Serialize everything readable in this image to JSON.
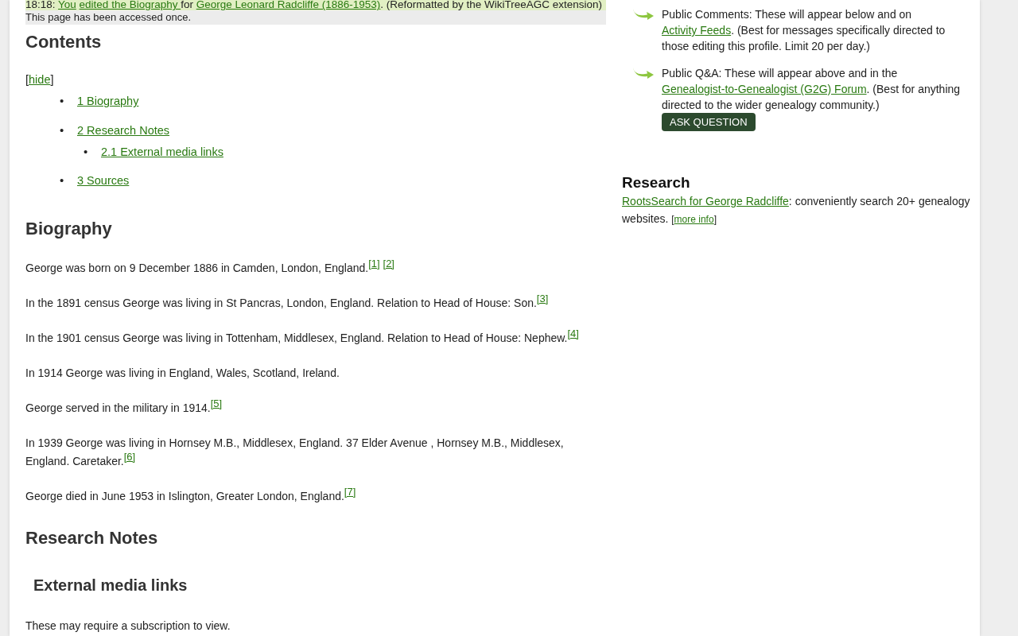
{
  "activity": {
    "segments": [
      {
        "kind": "text",
        "text": "18:18: "
      },
      {
        "kind": "link",
        "text": "You",
        "space_after": true
      },
      {
        "kind": "link",
        "text": "edited the Biography "
      },
      {
        "kind": "text",
        "text": "for "
      },
      {
        "kind": "link",
        "text": "George Leonard Radcliffe (1886-1953)"
      },
      {
        "kind": "text",
        "text": ". (Reformatted by the WikiTreeAGC extension)"
      }
    ]
  },
  "access_note": "This page has been accessed once.",
  "contents": {
    "title": "Contents",
    "toggle_open": "[",
    "toggle_link": "hide",
    "toggle_close": "]",
    "items": [
      {
        "marker": "•",
        "label": "1 Biography"
      },
      {
        "marker": "•",
        "label": "2 Research Notes",
        "children": [
          {
            "marker": "•",
            "label": "2.1 External media links"
          }
        ]
      },
      {
        "marker": "•",
        "label": "3 Sources"
      }
    ]
  },
  "biography": {
    "title": "Biography",
    "paragraphs": [
      [
        {
          "kind": "text",
          "text": "George was born on 9 December 1886 in Camden, London, England."
        },
        {
          "kind": "ref",
          "text": "[1]",
          "space_after": true
        },
        {
          "kind": "ref",
          "text": "[2]"
        }
      ],
      [
        {
          "kind": "text",
          "text": "In the 1891 census George was living in St Pancras, London, England. Relation to Head of House: Son."
        },
        {
          "kind": "ref",
          "text": "[3]"
        }
      ],
      [
        {
          "kind": "text",
          "text": "In the 1901 census George was living in Tottenham, Middlesex, England. Relation to Head of House: Nephew."
        },
        {
          "kind": "ref",
          "text": "[4]"
        }
      ],
      [
        {
          "kind": "text",
          "text": "In 1914 George was living in England, Wales, Scotland, Ireland."
        }
      ],
      [
        {
          "kind": "text",
          "text": "George served in the military in 1914."
        },
        {
          "kind": "ref",
          "text": "[5]"
        }
      ],
      [
        {
          "kind": "text",
          "text": "In 1939 George was living in Hornsey M.B., Middlesex, England. 37 Elder Avenue , Hornsey M.B., Middlesex, England. Caretaker."
        },
        {
          "kind": "ref",
          "text": "[6]"
        }
      ],
      [
        {
          "kind": "text",
          "text": "George died in June 1953 in Islington, Greater London, England."
        },
        {
          "kind": "ref",
          "text": "[7]"
        }
      ]
    ]
  },
  "research_notes": {
    "title": "Research Notes",
    "subtitle": "External media links",
    "note": "These may require a subscription to view."
  },
  "comments": [
    {
      "segments": [
        {
          "kind": "text",
          "text": "Public Comments: These will appear below and on "
        },
        {
          "kind": "link",
          "text": "Activity Feeds"
        },
        {
          "kind": "text",
          "text": ". (Best for messages specifically directed to those editing this profile. Limit 20 per day.)"
        }
      ]
    },
    {
      "segments": [
        {
          "kind": "text",
          "text": "Public Q&A: These will appear above and in the "
        },
        {
          "kind": "link",
          "text": "Genealogist-to-Genealogist (G2G) Forum"
        },
        {
          "kind": "text",
          "text": ". (Best for anything directed to the wider genealogy community.)"
        }
      ],
      "button": "ASK QUESTION"
    }
  ],
  "research": {
    "title": "Research",
    "segments": [
      {
        "kind": "link",
        "text": "RootsSearch for George Radcliffe"
      },
      {
        "kind": "text",
        "text": ": conveniently search 20+ genealogy websites. "
      },
      {
        "kind": "small",
        "text": "["
      },
      {
        "kind": "smalllink",
        "text": "more info"
      },
      {
        "kind": "small",
        "text": "]"
      }
    ]
  }
}
